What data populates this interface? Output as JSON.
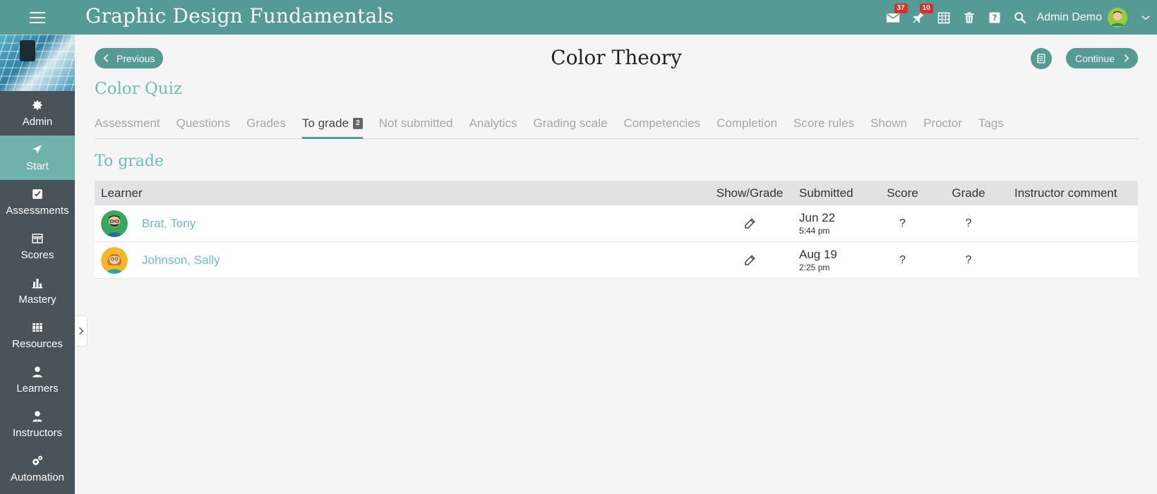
{
  "header": {
    "course_title": "Graphic Design Fundamentals",
    "messages_count": "37",
    "notifications_count": "10",
    "username": "Admin Demo"
  },
  "sidebar": {
    "items": [
      {
        "label": "Admin",
        "icon": "gear-icon"
      },
      {
        "label": "Start",
        "icon": "location-arrow-icon"
      },
      {
        "label": "Assessments",
        "icon": "checkbox-icon"
      },
      {
        "label": "Scores",
        "icon": "scores-icon"
      },
      {
        "label": "Mastery",
        "icon": "bar-chart-icon"
      },
      {
        "label": "Resources",
        "icon": "books-icon"
      },
      {
        "label": "Learners",
        "icon": "person-icon"
      },
      {
        "label": "Instructors",
        "icon": "instructor-icon"
      },
      {
        "label": "Automation",
        "icon": "gears-icon"
      }
    ],
    "active": "Start"
  },
  "nav": {
    "previous_label": "Previous",
    "continue_label": "Continue",
    "lesson_title": "Color Theory"
  },
  "quiz_title": "Color Quiz",
  "tabs": [
    {
      "label": "Assessment"
    },
    {
      "label": "Questions"
    },
    {
      "label": "Grades"
    },
    {
      "label": "To grade",
      "count": "2",
      "active": true
    },
    {
      "label": "Not submitted"
    },
    {
      "label": "Analytics"
    },
    {
      "label": "Grading scale"
    },
    {
      "label": "Competencies"
    },
    {
      "label": "Completion"
    },
    {
      "label": "Score rules"
    },
    {
      "label": "Shown"
    },
    {
      "label": "Proctor"
    },
    {
      "label": "Tags"
    }
  ],
  "section_title": "To grade",
  "table": {
    "columns": {
      "learner": "Learner",
      "show_grade": "Show/Grade",
      "submitted": "Submitted",
      "score": "Score",
      "grade": "Grade",
      "comment": "Instructor comment"
    },
    "rows": [
      {
        "name": "Brat, Tony",
        "date": "Jun 22",
        "time": "5:44 pm",
        "score": "?",
        "grade": "?",
        "comment": ""
      },
      {
        "name": "Johnson, Sally",
        "date": "Aug 19",
        "time": "2:25 pm",
        "score": "?",
        "grade": "?",
        "comment": ""
      }
    ]
  },
  "colors": {
    "primary": "#559a94",
    "accent": "#6cbfb6",
    "sidebar": "#4a535a",
    "active_sidebar": "#6fb2ab",
    "badge": "#d9302c"
  }
}
